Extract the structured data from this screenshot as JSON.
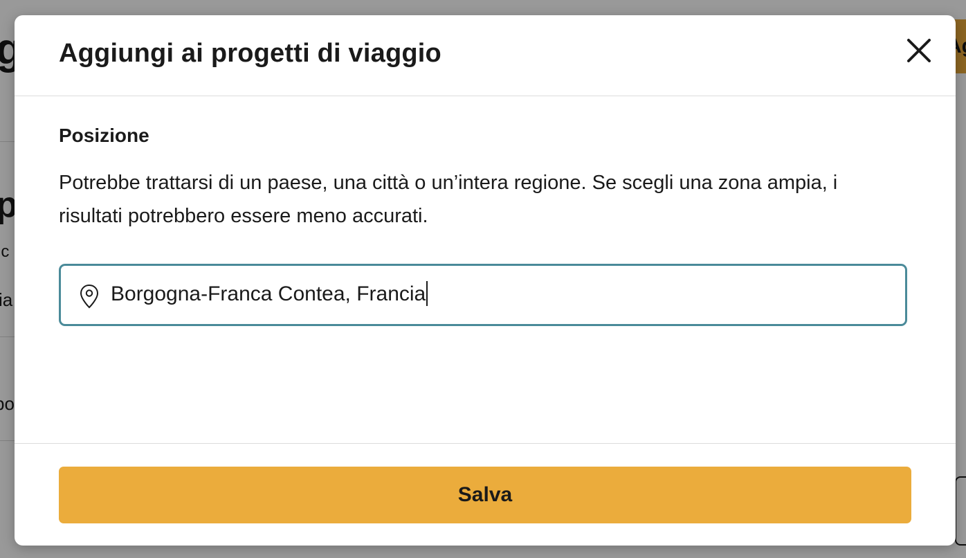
{
  "background": {
    "fragments": [
      "g",
      "p",
      "ic",
      "ia",
      "po",
      "Ag"
    ]
  },
  "modal": {
    "title": "Aggiungi ai progetti di viaggio",
    "close_icon": "close-icon",
    "section_label": "Posizione",
    "description": "Potrebbe trattarsi di un paese, una città o un’intera regione. Se scegli una zona ampia, i risultati potrebbero essere meno accurati.",
    "location_field": {
      "icon": "map-pin-icon",
      "value": "Borgogna-Franca Contea, Francia"
    },
    "save_label": "Salva"
  },
  "colors": {
    "accent": "#ebac3c",
    "field_border": "#4a8a99",
    "text": "#1a1a1a"
  }
}
